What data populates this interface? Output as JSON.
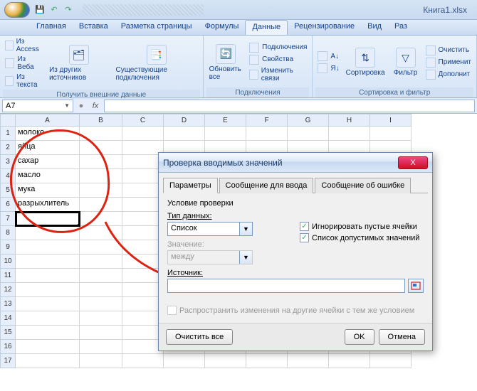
{
  "title": {
    "filename": "Книга1.xlsx"
  },
  "tabs": {
    "home": "Главная",
    "insert": "Вставка",
    "layout": "Разметка страницы",
    "formulas": "Формулы",
    "data": "Данные",
    "review": "Рецензирование",
    "view": "Вид",
    "dev": "Раз"
  },
  "ribbon": {
    "access": "Из Access",
    "web": "Из Веба",
    "text": "Из текста",
    "other": "Из других источников",
    "existing": "Существующие подключения",
    "refresh": "Обновить все",
    "conns": "Подключения",
    "props": "Свойства",
    "edit_links": "Изменить связи",
    "sort1": "А↓",
    "sort2": "Я↓",
    "sort_btn": "Сортировка",
    "filter": "Фильтр",
    "clear": "Очистить",
    "reapply": "Применит",
    "advanced": "Дополнит",
    "grp1": "Получить внешние данные",
    "grp2": "Подключения",
    "grp3": "Сортировка и фильтр"
  },
  "namebox": "A7",
  "fx": "fx",
  "cols": [
    "A",
    "B",
    "C",
    "D",
    "E",
    "F",
    "G",
    "H",
    "I"
  ],
  "rows": 17,
  "cells": {
    "a1": "молоко",
    "a2": "яйца",
    "a3": "сахар",
    "a4": "масло",
    "a5": "мука",
    "a6": "разрыхлитель"
  },
  "dialog": {
    "title": "Проверка вводимых значений",
    "tab1": "Параметры",
    "tab2": "Сообщение для ввода",
    "tab3": "Сообщение об ошибке",
    "section": "Условие проверки",
    "type_lbl": "Тип данных:",
    "type_val": "Список",
    "value_lbl": "Значение:",
    "value_val": "между",
    "chk1": "Игнорировать пустые ячейки",
    "chk2": "Список допустимых значений",
    "src_lbl": "Источник:",
    "apply_all": "Распространить изменения на другие ячейки с тем же условием",
    "clear_all": "Очистить все",
    "ok": "OK",
    "cancel": "Отмена",
    "close_x": "X"
  }
}
